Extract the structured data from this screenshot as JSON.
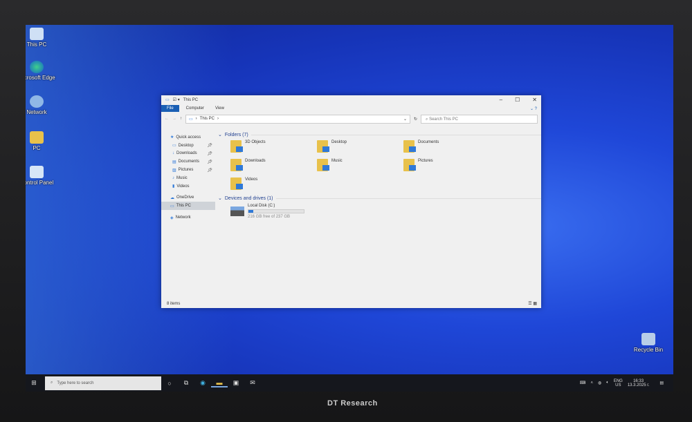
{
  "desktop": {
    "icons": [
      "This PC",
      "Microsoft Edge",
      "Network",
      "PC",
      "Control Panel",
      "Recycle Bin"
    ]
  },
  "window": {
    "title": "This PC",
    "tabs": [
      "File",
      "Computer",
      "View"
    ],
    "breadcrumb": [
      "This PC"
    ],
    "search_placeholder": "Search This PC",
    "nav": [
      {
        "label": "Quick access",
        "pinned": false
      },
      {
        "label": "Desktop",
        "pinned": true
      },
      {
        "label": "Downloads",
        "pinned": true
      },
      {
        "label": "Documents",
        "pinned": true
      },
      {
        "label": "Pictures",
        "pinned": true
      },
      {
        "label": "Music",
        "pinned": false
      },
      {
        "label": "Videos",
        "pinned": false
      },
      {
        "label": "OneDrive",
        "pinned": false
      },
      {
        "label": "This PC",
        "pinned": false
      },
      {
        "label": "Network",
        "pinned": false
      }
    ],
    "folders_header": "Folders (7)",
    "folders": [
      "3D Objects",
      "Desktop",
      "Documents",
      "Downloads",
      "Music",
      "Pictures",
      "Videos"
    ],
    "drives_header": "Devices and drives (1)",
    "drive": {
      "name": "Local Disk (C:)",
      "free": "216 GB free of 237 GB",
      "used_fraction": 0.09
    },
    "status": "8 items"
  },
  "taskbar": {
    "search_placeholder": "Type here to search",
    "lang": "ENG",
    "region": "US",
    "time": "16:33",
    "date": "13.3.2025 г."
  },
  "bezel": {
    "brand": "DT Research"
  },
  "colors": {
    "accent": "#1a5fb4",
    "desktop": "#1f47d8"
  }
}
